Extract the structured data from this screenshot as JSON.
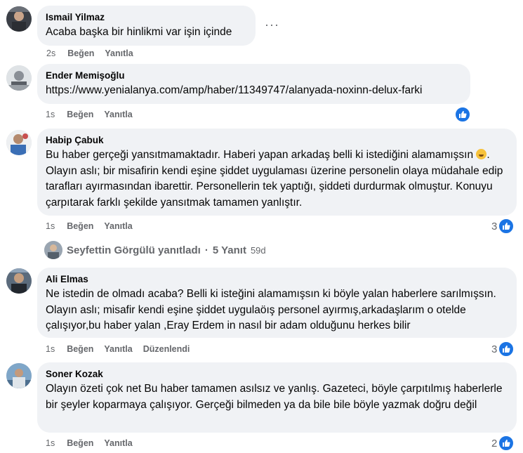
{
  "comments": [
    {
      "author": "Ismail Yilmaz",
      "text": "Acaba başka bir hinlikmi var işin içinde",
      "time": "2s",
      "like": "Beğen",
      "reply": "Yanıtla"
    },
    {
      "author": "Ender Memişoğlu",
      "text": "https://www.yenialanya.com/amp/haber/11349747/alanyada-noxinn-delux-farki",
      "time": "1s",
      "like": "Beğen",
      "reply": "Yanıtla"
    },
    {
      "author": "Habip Çabuk",
      "text_a": "Bu haber gerçeği yansıtmamaktadır. Haberi yapan arkadaş belli ki istediğini alamamışsın",
      "text_b": ". Olayın aslı; bir misafirin kendi eşine şiddet uygulaması üzerine personelin olaya müdahale edip tarafları ayırmasından ibarettir. Personellerin tek yaptığı, şiddeti durdurmak olmuştur. Konuyu çarpıtarak farklı şekilde yansıtmak tamamen yanlıştır.",
      "time": "1s",
      "like": "Beğen",
      "reply": "Yanıtla",
      "reaction_count": "3"
    },
    {
      "author": "Ali Elmas",
      "text": "Ne istedin de olmadı acaba? Belli ki isteğini alamamışsın ki böyle yalan haberlere sarılmışsın. Olayın aslı; misafir kendi eşine şiddet uygulaöış personel ayırmış,arkadaşlarım o otelde çalışıyor,bu haber yalan ,Eray Erdem in nasıl bir adam olduğunu herkes bilir",
      "time": "1s",
      "like": "Beğen",
      "reply": "Yanıtla",
      "edited": "Düzenlendi",
      "reaction_count": "3"
    },
    {
      "author": "Soner Kozak",
      "text": "Olayın özeti çok net Bu haber tamamen asılsız ve yanlış. Gazeteci, böyle çarpıtılmış haberlerle bir şeyler koparmaya çalışıyor. Gerçeği bilmeden ya da bile bile böyle yazmak doğru değil",
      "time": "1s",
      "like": "Beğen",
      "reply": "Yanıtla",
      "reaction_count": "2"
    }
  ],
  "reply_summary": {
    "label": "Seyfettin Görgülü yanıtladı",
    "separator": "·",
    "count": "5 Yanıt",
    "ago": "59d"
  },
  "more_options": "···",
  "colors": {
    "bubble": "#f0f2f5",
    "meta_text": "#65676b",
    "like_blue": "#1b74e4"
  },
  "icons": [
    "more-options-icon",
    "like-reaction-icon",
    "laughing-emoji-icon"
  ]
}
